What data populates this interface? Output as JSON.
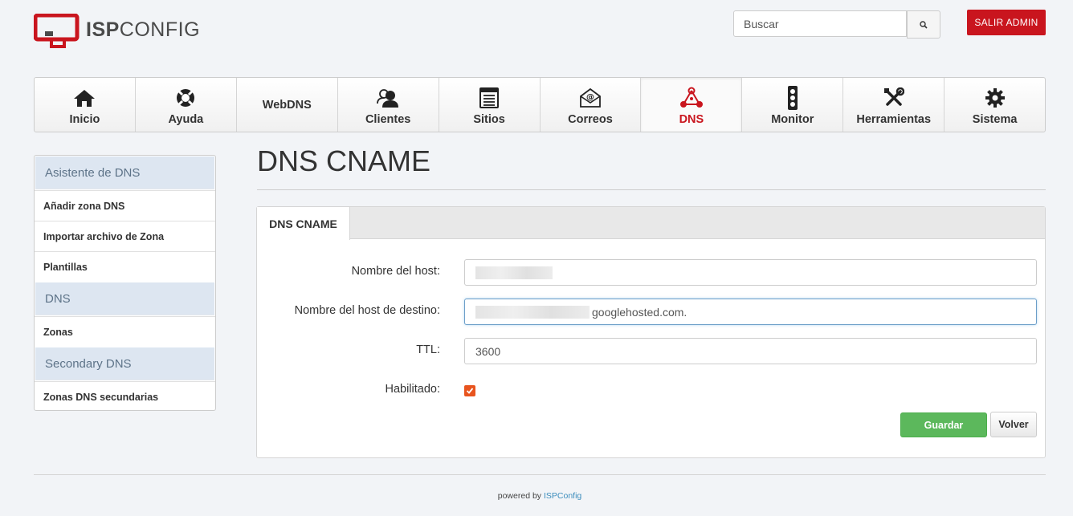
{
  "header": {
    "logo_bold": "ISP",
    "logo_light": "CONFIG",
    "search_placeholder": "Buscar",
    "logout_label": "SALIR ADMIN"
  },
  "nav": {
    "items": [
      {
        "label": "Inicio",
        "icon": "home-icon"
      },
      {
        "label": "Ayuda",
        "icon": "lifebuoy-icon"
      },
      {
        "label": "WebDNS",
        "icon": ""
      },
      {
        "label": "Clientes",
        "icon": "users-icon"
      },
      {
        "label": "Sitios",
        "icon": "browser-window-icon"
      },
      {
        "label": "Correos",
        "icon": "envelope-at-icon"
      },
      {
        "label": "DNS",
        "icon": "network-nodes-icon",
        "active": true
      },
      {
        "label": "Monitor",
        "icon": "traffic-light-icon"
      },
      {
        "label": "Herramientas",
        "icon": "tools-icon"
      },
      {
        "label": "Sistema",
        "icon": "gear-icon"
      }
    ]
  },
  "sidebar": {
    "sections": [
      {
        "heading": "Asistente de DNS",
        "items": [
          "Añadir zona DNS",
          "Importar archivo de Zona",
          "Plantillas"
        ]
      },
      {
        "heading": "DNS",
        "items": [
          "Zonas"
        ]
      },
      {
        "heading": "Secondary DNS",
        "items": [
          "Zonas DNS secundarias"
        ]
      }
    ]
  },
  "main": {
    "title": "DNS CNAME",
    "tab_label": "DNS CNAME",
    "form": {
      "host_label": "Nombre del host:",
      "host_value": "",
      "target_label": "Nombre del host de destino:",
      "target_value_visible": "googlehosted.com.",
      "ttl_label": "TTL:",
      "ttl_value": "3600",
      "enabled_label": "Habilitado:",
      "enabled": true
    },
    "save_label": "Guardar",
    "back_label": "Volver"
  },
  "footer": {
    "prefix": "powered by",
    "link": "ISPConfig"
  },
  "colors": {
    "brand_red": "#c9151e",
    "save_green": "#5cb85c",
    "checkbox_orange": "#e8541e",
    "sidebar_heading_bg": "#dde6f1"
  }
}
